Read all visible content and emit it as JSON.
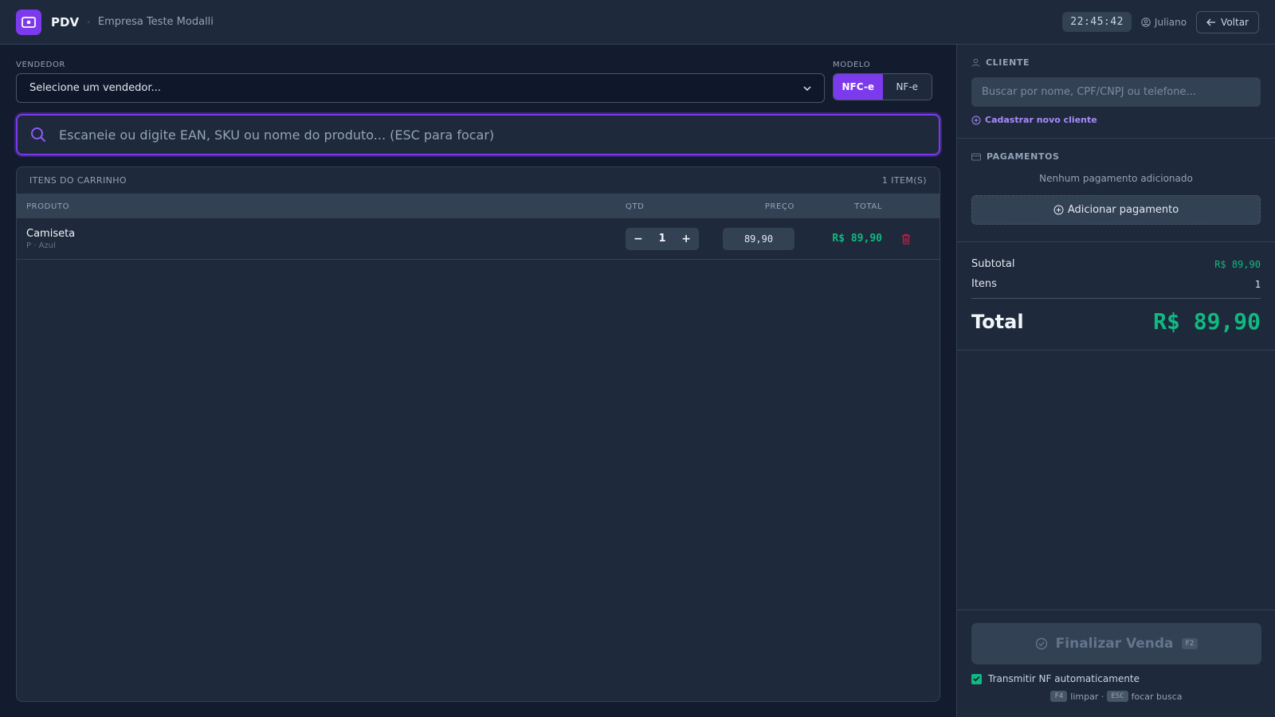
{
  "header": {
    "app_title": "PDV",
    "separator": "·",
    "company": "Empresa Teste Modalli",
    "clock": "22:45:42",
    "user": "Juliano",
    "back_label": "Voltar"
  },
  "vendor": {
    "label": "VENDEDOR",
    "selected": "Selecione um vendedor..."
  },
  "modelo": {
    "label": "MODELO",
    "options": [
      "NFC-e",
      "NF-e"
    ],
    "selected": "NFC-e"
  },
  "search": {
    "placeholder": "Escaneie ou digite EAN, SKU ou nome do produto... (ESC para focar)"
  },
  "cart": {
    "title": "ITENS DO CARRINHO",
    "count": "1 ITEM(S)",
    "columns": {
      "product": "PRODUTO",
      "qty": "QTD",
      "price": "PREÇO",
      "total": "TOTAL"
    },
    "items": [
      {
        "name": "Camiseta",
        "variant": "P · Azul",
        "minus": "−",
        "qty": "1",
        "plus": "+",
        "price": "89,90",
        "total": "R$ 89,90"
      }
    ]
  },
  "client": {
    "title": "CLIENTE",
    "placeholder": "Buscar por nome, CPF/CNPJ ou telefone...",
    "new_client": "Cadastrar novo cliente"
  },
  "payments": {
    "title": "PAGAMENTOS",
    "empty": "Nenhum pagamento adicionado",
    "add_label": "Adicionar pagamento"
  },
  "summary": {
    "subtotal_label": "Subtotal",
    "subtotal_value": "R$ 89,90",
    "items_label": "Itens",
    "items_value": "1",
    "total_label": "Total",
    "total_value": "R$ 89,90"
  },
  "footer": {
    "finalize_label": "Finalizar Venda",
    "finalize_key": "F2",
    "auto_nf_label": "Transmitir NF automaticamente",
    "auto_nf_checked": true,
    "shortcut1_key": "F4",
    "shortcut1_text": "limpar ·",
    "shortcut2_key": "ESC",
    "shortcut2_text": "focar busca"
  },
  "colors": {
    "accent": "#7c3aed",
    "success": "#10b981",
    "danger": "#e11d48"
  }
}
